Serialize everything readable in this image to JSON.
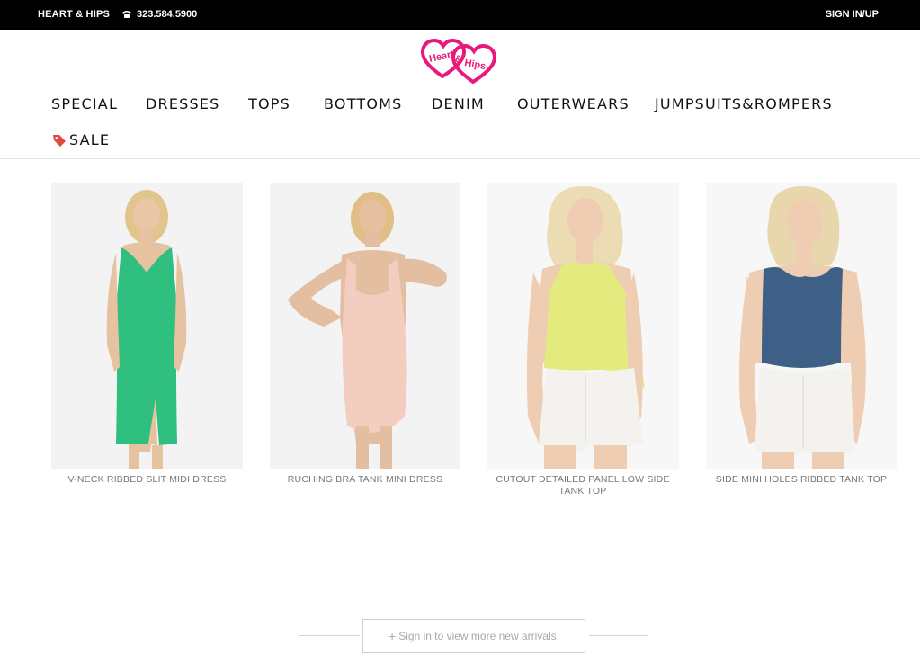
{
  "topbar": {
    "brand": "HEART & HIPS",
    "phone": "323.584.5900",
    "signin": "SIGN IN/UP"
  },
  "logo": {
    "text_left": "Heart",
    "text_amp": "&",
    "text_right": "Hips",
    "color": "#e8197d"
  },
  "nav": {
    "items": [
      "SPECIAL",
      "DRESSES",
      "TOPS",
      "BOTTOMS",
      "DENIM",
      "OUTERWEARS",
      "JUMPSUITS&ROMPERS"
    ],
    "sale": "SALE"
  },
  "products": [
    {
      "name": "V-NECK RIBBED SLIT MIDI DRESS",
      "garment_color": "#2fbf7e",
      "bg": "#f4f4f4"
    },
    {
      "name": "RUCHING BRA TANK MINI DRESS",
      "garment_color": "#f3cdbf",
      "bg": "#f4f4f4"
    },
    {
      "name": "CUTOUT DETAILED PANEL LOW SIDE TANK TOP",
      "garment_color": "#e3ea7e",
      "bg": "#f6f6f6"
    },
    {
      "name": "SIDE MINI HOLES RIBBED TANK TOP",
      "garment_color": "#3e5f86",
      "bg": "#f6f6f6"
    }
  ],
  "more": {
    "label": "Sign in to view more new arrivals.",
    "icon": "+"
  },
  "colors": {
    "topbar_bg": "#000000",
    "accent": "#e8197d"
  }
}
